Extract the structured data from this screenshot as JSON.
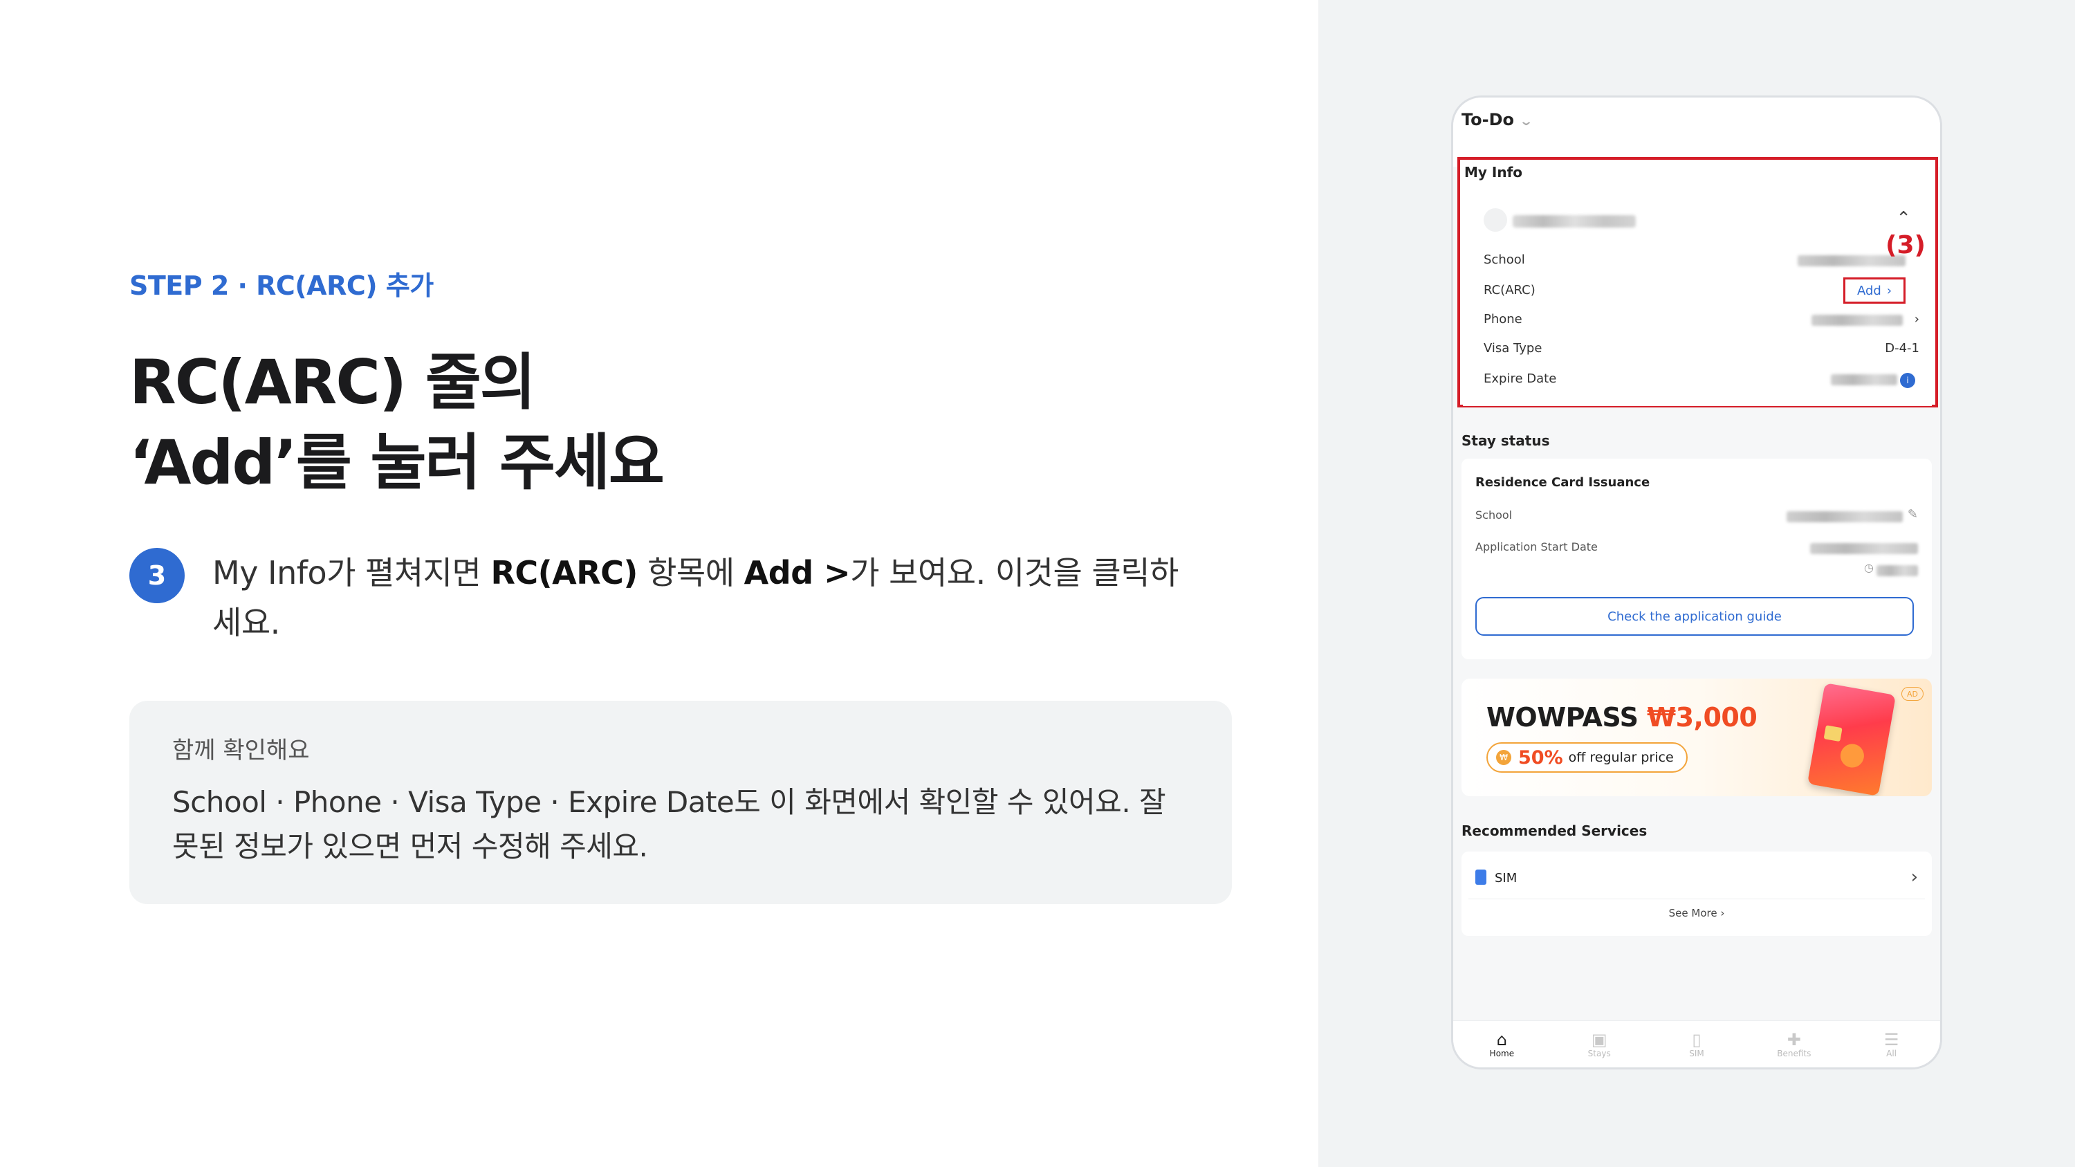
{
  "left": {
    "step_label": "STEP 2 · RC(ARC) 추가",
    "headline_line1": "RC(ARC) 줄의",
    "headline_line2": "‘Add’를 눌러 주세요",
    "step_number": "3",
    "step_text_parts": [
      "My Info가 펼쳐지면 ",
      "RC(ARC)",
      " 항목에 ",
      "Add >",
      "가 보여요. 이것을 클릭하세요."
    ],
    "note_title": "함께 확인해요",
    "note_body": "School · Phone · Visa Type · Expire Date도 이 화면에서 확인할 수 있어요. 잘못된 정보가 있으면 먼저 수정해 주세요."
  },
  "phone": {
    "todo_label": "To-Do",
    "my_info_title": "My Info",
    "marker": "(3)",
    "rows": {
      "school": "School",
      "rc_arc": "RC(ARC)",
      "add_label": "Add",
      "phone": "Phone",
      "visa_type": "Visa Type",
      "visa_value": "D-4-1",
      "expire_date": "Expire Date"
    },
    "stay_status_title": "Stay status",
    "stay_card": {
      "title": "Residence Card Issuance",
      "school": "School",
      "application_start": "Application Start Date",
      "guide_button": "Check the application guide"
    },
    "promo": {
      "brand": "WOWPASS",
      "amount": "₩3,000",
      "percent": "50%",
      "pill_text": "off regular price",
      "ad_badge": "AD"
    },
    "recommended_title": "Recommended Services",
    "sim_label": "SIM",
    "see_more": "See More",
    "nav": [
      "Home",
      "Stays",
      "SIM",
      "Benefits",
      "All"
    ]
  },
  "colors": {
    "accent": "#2f6bd1",
    "highlight_red": "#d51d28",
    "promo_orange": "#f04c23"
  }
}
